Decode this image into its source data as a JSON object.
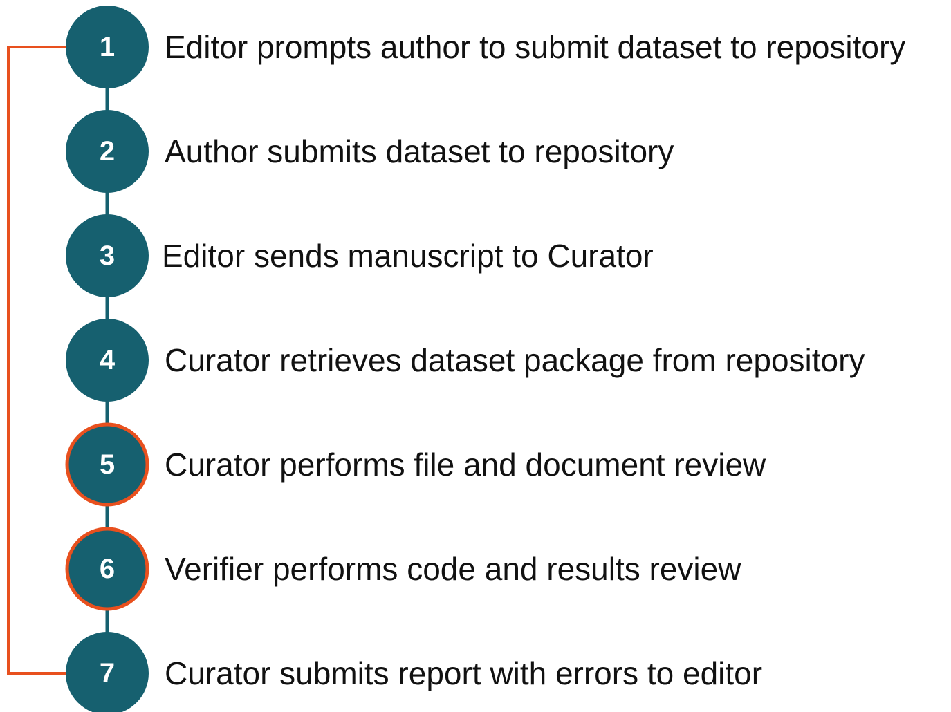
{
  "colors": {
    "node_fill": "#16606f",
    "highlight_border": "#e8501e",
    "loop_line": "#e8501e",
    "connector": "#16606f",
    "text": "#111111",
    "number": "#ffffff"
  },
  "steps": [
    {
      "number": "1",
      "text": "Editor prompts author to submit dataset to repository",
      "highlighted": false
    },
    {
      "number": "2",
      "text": "Author submits dataset to repository",
      "highlighted": false
    },
    {
      "number": "3",
      "text": "Editor sends manuscript to Curator",
      "highlighted": false
    },
    {
      "number": "4",
      "text": "Curator retrieves dataset package from repository",
      "highlighted": false
    },
    {
      "number": "5",
      "text": "Curator performs file and document review",
      "highlighted": true
    },
    {
      "number": "6",
      "text": "Verifier performs code and results review",
      "highlighted": true
    },
    {
      "number": "7",
      "text": "Curator submits report with errors to editor",
      "highlighted": false
    }
  ]
}
